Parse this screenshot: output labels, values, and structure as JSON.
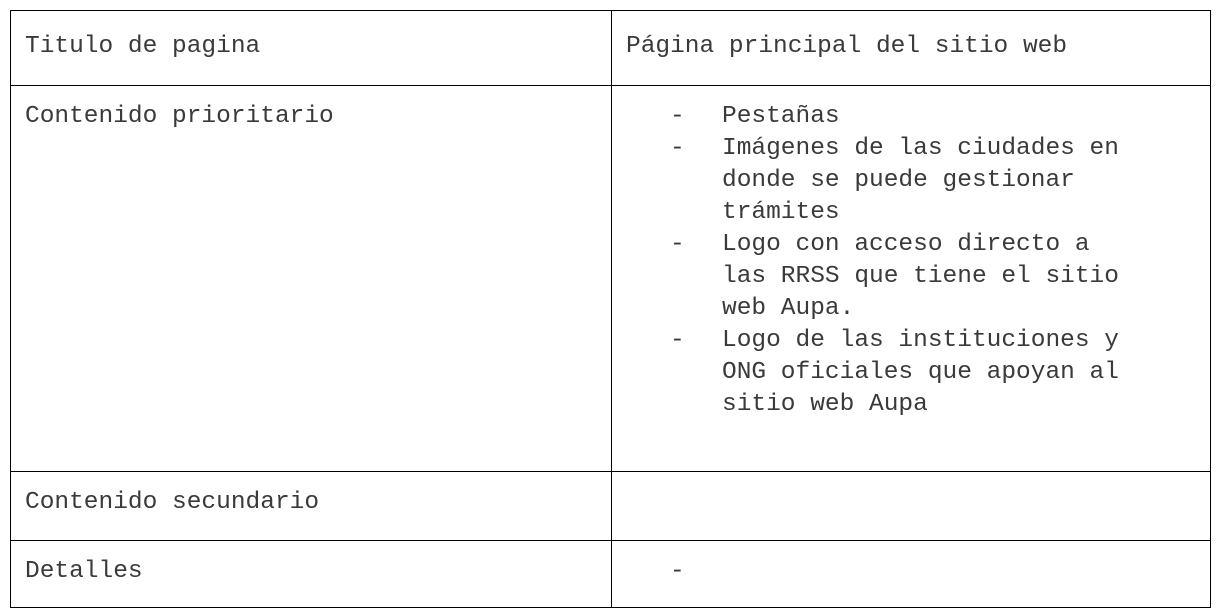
{
  "table": {
    "rows": [
      {
        "label": "Titulo de pagina",
        "value": "Página principal del sitio web"
      },
      {
        "label": "Contenido prioritario",
        "items": [
          "Pestañas",
          "Imágenes de las ciudades en\ndonde se puede gestionar\ntrámites",
          "Logo con acceso directo a\nlas RRSS que tiene el sitio\nweb Aupa.",
          "Logo de las instituciones y\nONG oficiales que apoyan al\nsitio web Aupa"
        ]
      },
      {
        "label": "Contenido secundario",
        "value": ""
      },
      {
        "label": "Detalles",
        "value": "-"
      }
    ],
    "bullet_symbol": "-"
  }
}
